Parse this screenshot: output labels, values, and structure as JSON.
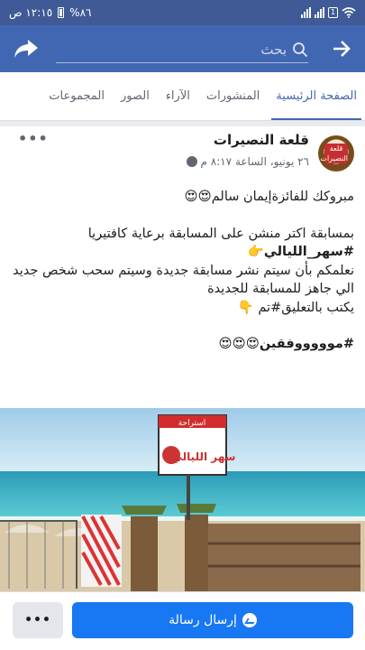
{
  "status_bar": {
    "time": "١٢:١٥ ص",
    "battery": "%٨٦",
    "sim_label": "1",
    "network": "LTE"
  },
  "top_bar": {
    "search_placeholder": "بحث",
    "back_icon": "arrow-right-icon",
    "share_icon": "share-icon"
  },
  "tabs": [
    {
      "label": "الصفحة الرئيسية",
      "active": true
    },
    {
      "label": "المنشورات",
      "active": false
    },
    {
      "label": "الآراء",
      "active": false
    },
    {
      "label": "الصور",
      "active": false
    },
    {
      "label": "المجموعات",
      "active": false
    }
  ],
  "post": {
    "page_name": "قلعة النصيرات",
    "avatar_text": "قلعة النصيرات",
    "date": "٢٦ يونيو، الساعة ٨:١٧ م",
    "more": "•••",
    "lines": {
      "l1": "مبروكك للفائزةإيمان سالم😍😍",
      "l2": "بمسابقة اكتر منشن على المسابقة برعاية كافتيريا",
      "l3": "#سهر_الليالي👉",
      "l4": "نعلمكم بأن سيتم نشر مسابقة جديدة وسيتم سحب شخص جديد",
      "l5": "الي جاهز للمسابقة للجديدة",
      "l6": "يكتب بالتعليق#تم 👇",
      "l7": "#موووووفقين😍😍😍"
    },
    "photo_sign_top": "استراحة",
    "photo_sign_main": "سهر الليالي"
  },
  "bottom_bar": {
    "send_message": "إرسال رسالة",
    "more": "•••"
  },
  "colors": {
    "header": "#4267b2",
    "status": "#3f5a96",
    "accent": "#1877f2"
  }
}
